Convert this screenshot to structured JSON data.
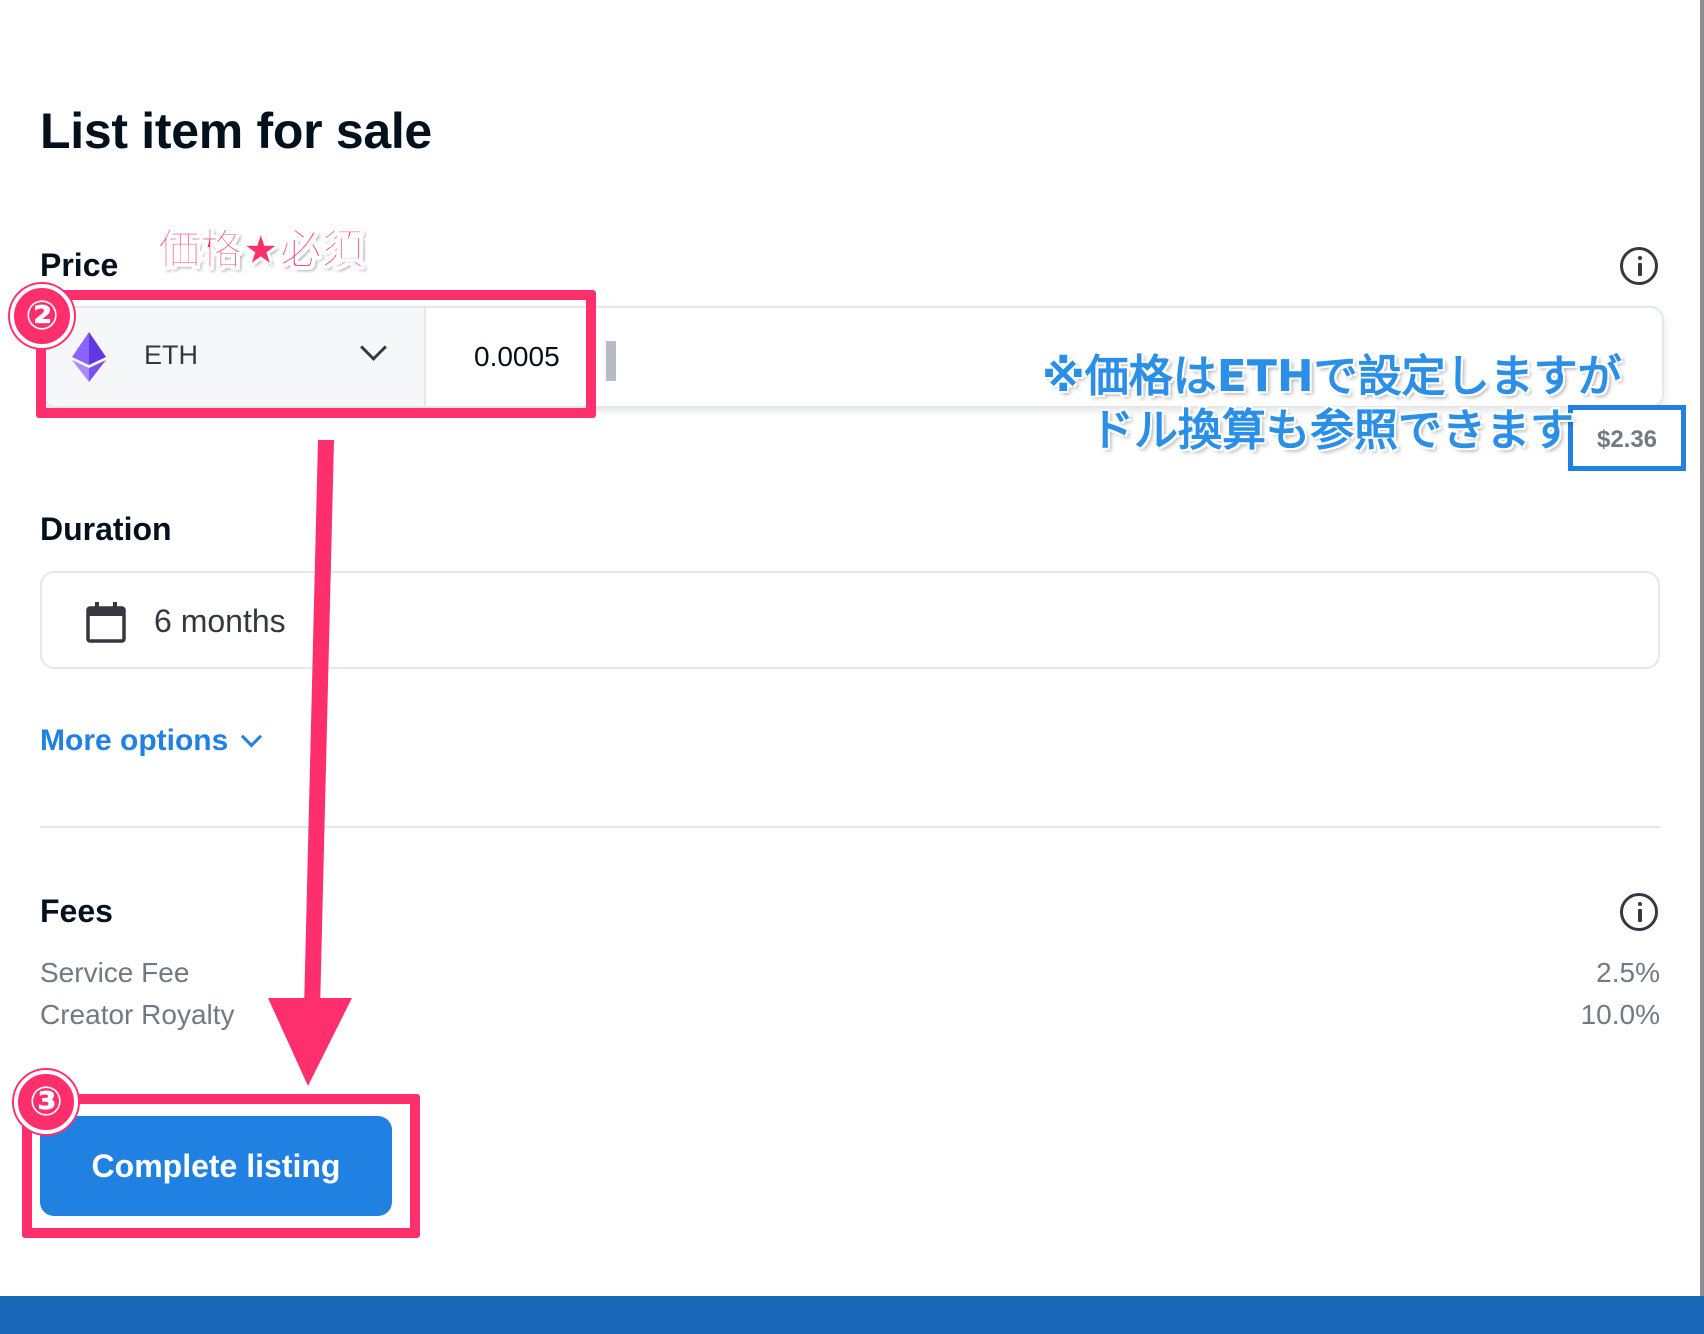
{
  "title": "List item for sale",
  "price": {
    "label": "Price",
    "currency": "ETH",
    "amount": "0.0005",
    "usd_value": "$2.36"
  },
  "duration": {
    "label": "Duration",
    "value": "6 months"
  },
  "more_options": "More options",
  "fees": {
    "label": "Fees",
    "items": [
      {
        "name": "Service Fee",
        "value": "2.5%"
      },
      {
        "name": "Creator Royalty",
        "value": "10.0%"
      }
    ]
  },
  "complete_button": "Complete listing",
  "annotations": {
    "step2_marker": "②",
    "step3_marker": "③",
    "price_required_note": "価格★必須",
    "conversion_note_line1": "※価格はETHで設定しますが",
    "conversion_note_line2": "ドル換算も参照できます",
    "pink_color": "#ff2f6e",
    "blue_color": "#2b8fe8"
  },
  "colors": {
    "accent": "#2081e2",
    "text_primary": "#04111d",
    "text_secondary": "#707a83",
    "eth_purple": "#8a64ff"
  },
  "icons": {
    "eth": "ethereum-icon",
    "calendar": "calendar-icon",
    "info": "info-icon",
    "chevron": "chevron-down-icon"
  }
}
